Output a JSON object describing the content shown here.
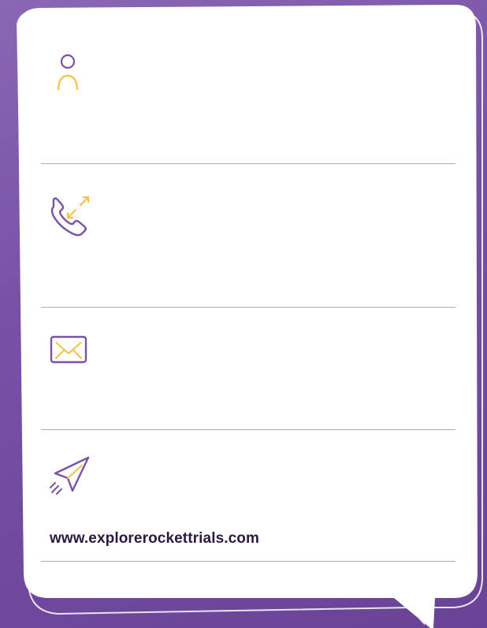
{
  "contact_card": {
    "fields": [
      {
        "id": "name",
        "icon": "person-icon"
      },
      {
        "id": "phone",
        "icon": "phone-call-icon"
      },
      {
        "id": "email",
        "icon": "envelope-icon"
      },
      {
        "id": "website",
        "icon": "paper-plane-icon"
      }
    ],
    "website": "www.explorerockettrials.com"
  },
  "colors": {
    "background": "#7751a6",
    "card": "#ffffff",
    "icon_purple": "#7a52a8",
    "icon_yellow": "#f5c244",
    "divider": "#b9a6d3",
    "text": "#2a1a40"
  }
}
